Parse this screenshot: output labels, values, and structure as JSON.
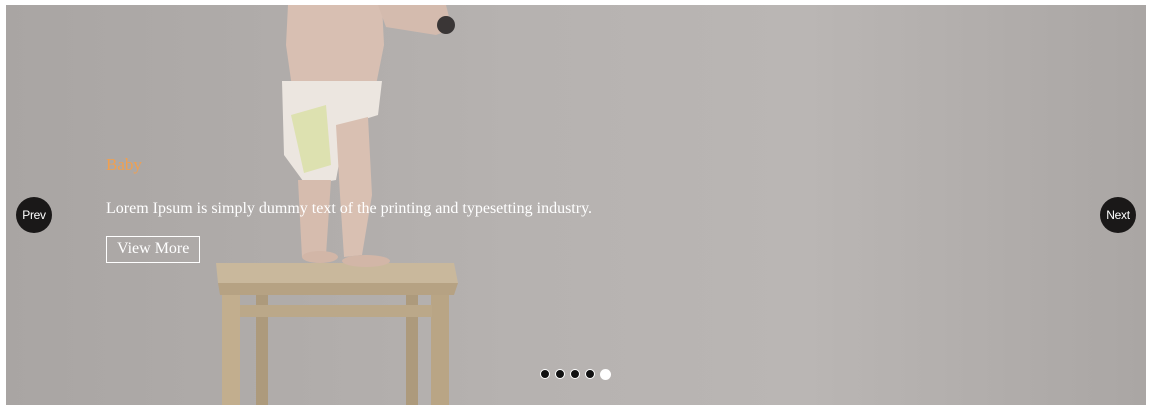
{
  "slider": {
    "slide": {
      "title": "Baby",
      "text": "Lorem Ipsum is simply dummy text of the printing and typesetting industry.",
      "button_label": "View More"
    },
    "prev_label": "Prev",
    "next_label": "Next",
    "dots": {
      "count": 5,
      "active_index": 4
    },
    "colors": {
      "title": "#f0a050",
      "nav_background": "#1a1818",
      "text": "#ffffff"
    }
  }
}
